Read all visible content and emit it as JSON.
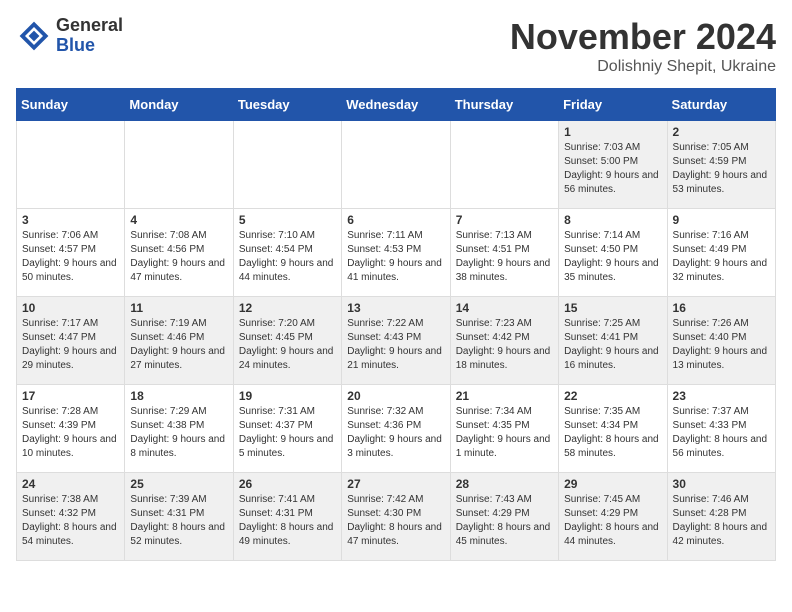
{
  "logo": {
    "general": "General",
    "blue": "Blue"
  },
  "title": "November 2024",
  "subtitle": "Dolishniy Shepit, Ukraine",
  "days_of_week": [
    "Sunday",
    "Monday",
    "Tuesday",
    "Wednesday",
    "Thursday",
    "Friday",
    "Saturday"
  ],
  "weeks": [
    [
      {
        "day": "",
        "info": ""
      },
      {
        "day": "",
        "info": ""
      },
      {
        "day": "",
        "info": ""
      },
      {
        "day": "",
        "info": ""
      },
      {
        "day": "",
        "info": ""
      },
      {
        "day": "1",
        "info": "Sunrise: 7:03 AM\nSunset: 5:00 PM\nDaylight: 9 hours and 56 minutes."
      },
      {
        "day": "2",
        "info": "Sunrise: 7:05 AM\nSunset: 4:59 PM\nDaylight: 9 hours and 53 minutes."
      }
    ],
    [
      {
        "day": "3",
        "info": "Sunrise: 7:06 AM\nSunset: 4:57 PM\nDaylight: 9 hours and 50 minutes."
      },
      {
        "day": "4",
        "info": "Sunrise: 7:08 AM\nSunset: 4:56 PM\nDaylight: 9 hours and 47 minutes."
      },
      {
        "day": "5",
        "info": "Sunrise: 7:10 AM\nSunset: 4:54 PM\nDaylight: 9 hours and 44 minutes."
      },
      {
        "day": "6",
        "info": "Sunrise: 7:11 AM\nSunset: 4:53 PM\nDaylight: 9 hours and 41 minutes."
      },
      {
        "day": "7",
        "info": "Sunrise: 7:13 AM\nSunset: 4:51 PM\nDaylight: 9 hours and 38 minutes."
      },
      {
        "day": "8",
        "info": "Sunrise: 7:14 AM\nSunset: 4:50 PM\nDaylight: 9 hours and 35 minutes."
      },
      {
        "day": "9",
        "info": "Sunrise: 7:16 AM\nSunset: 4:49 PM\nDaylight: 9 hours and 32 minutes."
      }
    ],
    [
      {
        "day": "10",
        "info": "Sunrise: 7:17 AM\nSunset: 4:47 PM\nDaylight: 9 hours and 29 minutes."
      },
      {
        "day": "11",
        "info": "Sunrise: 7:19 AM\nSunset: 4:46 PM\nDaylight: 9 hours and 27 minutes."
      },
      {
        "day": "12",
        "info": "Sunrise: 7:20 AM\nSunset: 4:45 PM\nDaylight: 9 hours and 24 minutes."
      },
      {
        "day": "13",
        "info": "Sunrise: 7:22 AM\nSunset: 4:43 PM\nDaylight: 9 hours and 21 minutes."
      },
      {
        "day": "14",
        "info": "Sunrise: 7:23 AM\nSunset: 4:42 PM\nDaylight: 9 hours and 18 minutes."
      },
      {
        "day": "15",
        "info": "Sunrise: 7:25 AM\nSunset: 4:41 PM\nDaylight: 9 hours and 16 minutes."
      },
      {
        "day": "16",
        "info": "Sunrise: 7:26 AM\nSunset: 4:40 PM\nDaylight: 9 hours and 13 minutes."
      }
    ],
    [
      {
        "day": "17",
        "info": "Sunrise: 7:28 AM\nSunset: 4:39 PM\nDaylight: 9 hours and 10 minutes."
      },
      {
        "day": "18",
        "info": "Sunrise: 7:29 AM\nSunset: 4:38 PM\nDaylight: 9 hours and 8 minutes."
      },
      {
        "day": "19",
        "info": "Sunrise: 7:31 AM\nSunset: 4:37 PM\nDaylight: 9 hours and 5 minutes."
      },
      {
        "day": "20",
        "info": "Sunrise: 7:32 AM\nSunset: 4:36 PM\nDaylight: 9 hours and 3 minutes."
      },
      {
        "day": "21",
        "info": "Sunrise: 7:34 AM\nSunset: 4:35 PM\nDaylight: 9 hours and 1 minute."
      },
      {
        "day": "22",
        "info": "Sunrise: 7:35 AM\nSunset: 4:34 PM\nDaylight: 8 hours and 58 minutes."
      },
      {
        "day": "23",
        "info": "Sunrise: 7:37 AM\nSunset: 4:33 PM\nDaylight: 8 hours and 56 minutes."
      }
    ],
    [
      {
        "day": "24",
        "info": "Sunrise: 7:38 AM\nSunset: 4:32 PM\nDaylight: 8 hours and 54 minutes."
      },
      {
        "day": "25",
        "info": "Sunrise: 7:39 AM\nSunset: 4:31 PM\nDaylight: 8 hours and 52 minutes."
      },
      {
        "day": "26",
        "info": "Sunrise: 7:41 AM\nSunset: 4:31 PM\nDaylight: 8 hours and 49 minutes."
      },
      {
        "day": "27",
        "info": "Sunrise: 7:42 AM\nSunset: 4:30 PM\nDaylight: 8 hours and 47 minutes."
      },
      {
        "day": "28",
        "info": "Sunrise: 7:43 AM\nSunset: 4:29 PM\nDaylight: 8 hours and 45 minutes."
      },
      {
        "day": "29",
        "info": "Sunrise: 7:45 AM\nSunset: 4:29 PM\nDaylight: 8 hours and 44 minutes."
      },
      {
        "day": "30",
        "info": "Sunrise: 7:46 AM\nSunset: 4:28 PM\nDaylight: 8 hours and 42 minutes."
      }
    ]
  ]
}
